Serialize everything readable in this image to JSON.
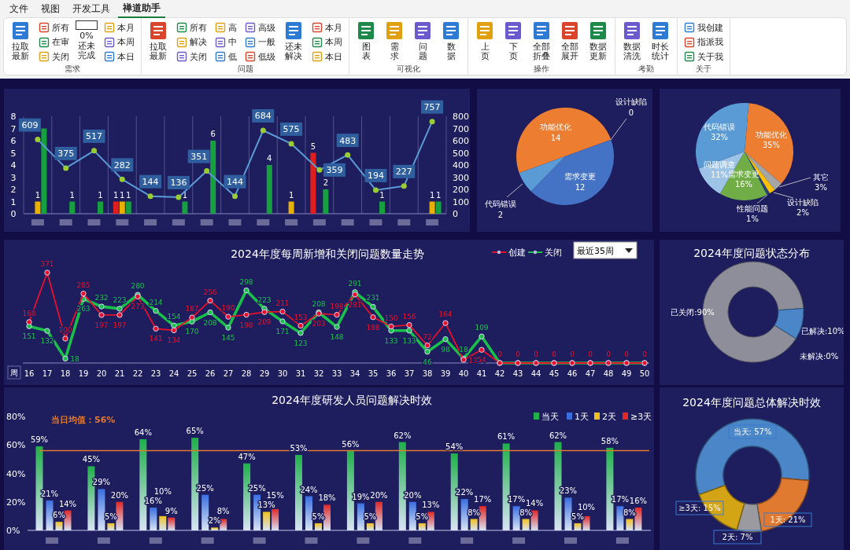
{
  "ribbon": {
    "tabs": [
      {
        "label": "文件",
        "selected": false
      },
      {
        "label": "视图",
        "selected": false
      },
      {
        "label": "开发工具",
        "selected": false
      },
      {
        "label": "禅道助手",
        "selected": true
      }
    ],
    "groups": [
      {
        "label": "需求",
        "columns": [
          {
            "kind": "large",
            "label": "拉取最新"
          },
          {
            "kind": "stack",
            "items": [
              "所有",
              "在审",
              "关闭"
            ]
          },
          {
            "kind": "progress",
            "value": "0%",
            "label": "还未完成",
            "level": 0
          },
          {
            "kind": "stack",
            "items": [
              "本月",
              "本周",
              "本日"
            ]
          }
        ]
      },
      {
        "label": "问题",
        "columns": [
          {
            "kind": "large",
            "label": "拉取最新"
          },
          {
            "kind": "stack",
            "items": [
              "所有",
              "解决",
              "关闭"
            ]
          },
          {
            "kind": "stack",
            "items": [
              "高",
              "中",
              "低"
            ]
          },
          {
            "kind": "stack",
            "items": [
              "高级",
              "一般",
              "低级"
            ]
          },
          {
            "kind": "large",
            "label": "还未解决"
          },
          {
            "kind": "stack",
            "items": [
              "本月",
              "本周",
              "本日"
            ]
          }
        ]
      },
      {
        "label": "可视化",
        "columns": [
          {
            "kind": "large",
            "label": "图表"
          },
          {
            "kind": "large",
            "label": "需求"
          },
          {
            "kind": "large",
            "label": "问题"
          },
          {
            "kind": "large",
            "label": "数据"
          }
        ]
      },
      {
        "label": "操作",
        "columns": [
          {
            "kind": "large",
            "label": "上页"
          },
          {
            "kind": "large",
            "label": "下页"
          },
          {
            "kind": "large",
            "label": "全部折叠"
          },
          {
            "kind": "large",
            "label": "全部展开"
          },
          {
            "kind": "large",
            "label": "数据更新"
          }
        ]
      },
      {
        "label": "考勤",
        "columns": [
          {
            "kind": "large",
            "label": "数据清洗"
          },
          {
            "kind": "large",
            "label": "时长统计"
          }
        ]
      },
      {
        "label": "关于",
        "columns": [
          {
            "kind": "stack",
            "items": [
              "我创建",
              "指派我",
              "关于我"
            ]
          }
        ]
      }
    ]
  },
  "dashboard": {
    "issue_chart": {
      "bar_chart": {
        "chart_data": {
          "type": "bar",
          "yticks": [
            0,
            1,
            2,
            3,
            4,
            5,
            6,
            7,
            8
          ],
          "ylim": [
            0,
            8
          ],
          "data_labels": true,
          "series": [
            {
              "color": "#e01e1e",
              "values": [
                0,
                0,
                0,
                1,
                0,
                0,
                0,
                0,
                0,
                0,
                5,
                0,
                0,
                0,
                0
              ],
              "value_labels": [
                null,
                null,
                null,
                "1",
                null,
                null,
                null,
                null,
                null,
                null,
                "5",
                null,
                null,
                null,
                null
              ]
            },
            {
              "color": "#e8b000",
              "values": [
                1,
                0,
                0,
                1,
                0,
                0,
                0,
                0,
                0,
                1,
                0,
                0,
                0,
                0,
                1
              ],
              "value_labels": [
                "1",
                null,
                null,
                "1",
                null,
                null,
                null,
                null,
                null,
                "1",
                null,
                null,
                null,
                null,
                "1"
              ]
            },
            {
              "color": "#16a040",
              "values": [
                7,
                1,
                1,
                1,
                0,
                1,
                6,
                0,
                4,
                0,
                2,
                0,
                1,
                0,
                1
              ],
              "value_labels": [
                null,
                "1",
                "1",
                "1",
                null,
                "1",
                "6",
                null,
                "4",
                null,
                "2",
                null,
                "1",
                null,
                "1"
              ]
            }
          ]
        }
      },
      "line_chart": {
        "chart_data": {
          "type": "line",
          "yticks": [
            0,
            100,
            200,
            300,
            400,
            500,
            600,
            700,
            800
          ],
          "ylim": [
            0,
            800
          ],
          "data_labels": true,
          "series": [
            {
              "color": "#5b9bd5",
              "marker": "circle",
              "values": [
                609,
                375,
                517,
                282,
                144,
                136,
                351,
                144,
                684,
                575,
                359,
                483,
                194,
                227,
                757
              ],
              "value_labels": [
                "609",
                "375",
                "517",
                "282",
                "144",
                "136",
                "351",
                "144",
                "684",
                "575",
                "359",
                "483",
                "194",
                "227",
                "757"
              ]
            }
          ]
        }
      }
    },
    "category_pie": {
      "chart_data": {
        "type": "pie",
        "categories": [
          "功能优化",
          "设计缺陷",
          "需求变更",
          "代码错误"
        ],
        "values": [
          14,
          0,
          12,
          2
        ],
        "value_labels": [
          "14",
          "0",
          "12",
          "2"
        ],
        "colors": [
          "#ed7d31",
          "#ffc000",
          "#4472c4",
          "#5b9bd5"
        ]
      }
    },
    "type_pie": {
      "chart_data": {
        "type": "pie",
        "categories": [
          "功能优化",
          "其它",
          "设计缺陷",
          "性能问题",
          "需求变更",
          "问题调查",
          "代码错误"
        ],
        "values": [
          35,
          3,
          2,
          1,
          16,
          11,
          32
        ],
        "value_labels": [
          "35%",
          "3%",
          "2%",
          "1%",
          "16%",
          "11%",
          "32%"
        ],
        "colors": [
          "#ed7d31",
          "#a5a5a5",
          "#ffc000",
          "#264478",
          "#70ad47",
          "#9dc3e6",
          "#5b9bd5"
        ]
      }
    },
    "weekly_trend": {
      "dropdown": {
        "value": "最近35周"
      },
      "chart_data": {
        "type": "line",
        "title": "2024年度每周新增和关闭问题数量走势",
        "xlabel": "周",
        "x": [
          "16",
          "17",
          "18",
          "19",
          "20",
          "21",
          "22",
          "23",
          "24",
          "25",
          "26",
          "27",
          "28",
          "29",
          "30",
          "31",
          "32",
          "33",
          "34",
          "35",
          "36",
          "37",
          "38",
          "39",
          "40",
          "41",
          "42",
          "43",
          "44",
          "45",
          "46",
          "47",
          "48",
          "49",
          "50"
        ],
        "legend": "top-right",
        "data_labels": true,
        "series": [
          {
            "name": "创建",
            "color": "#e8102a",
            "marker": "circle",
            "values": [
              168,
              371,
              100,
              285,
              197,
              197,
              273,
              141,
              134,
              187,
              256,
              190,
              198,
              209,
              211,
              153,
              203,
              198,
              281,
              188,
              150,
              156,
              72,
              164,
              13,
              54,
              0,
              0,
              0,
              0,
              0,
              0,
              0,
              0,
              0
            ],
            "value_labels": [
              "168",
              "371",
              "100",
              "285",
              "197",
              "197",
              "273",
              "141",
              "134",
              "187",
              "256",
              "190",
              "198",
              "209",
              "211",
              "153",
              "203",
              "198",
              "281",
              "188",
              "150",
              "156",
              "72",
              "164",
              "13",
              "54",
              "0",
              "0",
              "0",
              "0",
              "0",
              "0",
              "0",
              "0",
              "0"
            ]
          },
          {
            "name": "关闭",
            "color": "#19c04a",
            "marker": "circle",
            "values": [
              151,
              132,
              18,
              263,
              232,
              223,
              280,
              214,
              154,
              170,
              208,
              145,
              298,
              223,
              171,
              123,
              208,
              148,
              291,
              231,
              133,
              133,
              46,
              98,
              18,
              109,
              0,
              0,
              0,
              0,
              0,
              0,
              0,
              0,
              0
            ],
            "value_labels": [
              "151",
              "132",
              "18",
              "263",
              "232",
              "223",
              "280",
              "214",
              "154",
              "170",
              "208",
              "145",
              "298",
              "223",
              "171",
              "123",
              "208",
              "148",
              "291",
              "231",
              "133",
              "133",
              "46",
              "98",
              "18",
              "109",
              null,
              null,
              null,
              null,
              null,
              null,
              null,
              null,
              null
            ]
          }
        ]
      }
    },
    "status_donut": {
      "chart_data": {
        "type": "donut",
        "title": "2024年度问题状态分布",
        "values": [
          90,
          10,
          0
        ],
        "value_labels": [
          "已关闭:90%",
          "已解决:10%",
          "未解决:0%"
        ],
        "colors": [
          "#8e8e9a",
          "#4a86c8",
          "#e07a30"
        ]
      }
    },
    "resolution_chart": {
      "chart_data": {
        "type": "bar",
        "title": "2024年度研发人员问题解决时效",
        "yticks": [
          {
            "value": 0,
            "label": "0%"
          },
          {
            "value": 20,
            "label": "20%"
          },
          {
            "value": 40,
            "label": "40%"
          },
          {
            "value": 60,
            "label": "60%"
          },
          {
            "value": 80,
            "label": "80%"
          }
        ],
        "ylim": [
          0,
          80
        ],
        "legend": "top-right",
        "data_labels": true,
        "ref_lines": [
          {
            "value": 56,
            "axis": "y",
            "color": "#e07a30"
          }
        ],
        "annotations": [
          "当日均值：56%"
        ],
        "series": [
          {
            "name": "当天",
            "color": "#1fb04a",
            "values": [
              59,
              45,
              64,
              65,
              47,
              53,
              56,
              62,
              54,
              61,
              62,
              58
            ],
            "value_labels": [
              "59%",
              "45%",
              "64%",
              "65%",
              "47%",
              "53%",
              "56%",
              "62%",
              "54%",
              "61%",
              "62%",
              "58%"
            ]
          },
          {
            "name": "1天",
            "color": "#3a6ee0",
            "values": [
              21,
              29,
              16,
              25,
              25,
              24,
              19,
              20,
              22,
              17,
              23,
              17
            ],
            "value_labels": [
              "21%",
              "29%",
              "16%",
              "25%",
              "25%",
              "24%",
              "19%",
              "20%",
              "22%",
              "17%",
              "23%",
              "17%"
            ]
          },
          {
            "name": "2天",
            "color": "#f0c020",
            "values": [
              6,
              5,
              10,
              2,
              13,
              5,
              5,
              5,
              8,
              8,
              5,
              8
            ],
            "value_labels": [
              "6%",
              "5%",
              "10%",
              "2%",
              "13%",
              "5%",
              "5%",
              "5%",
              "8%",
              "8%",
              "5%",
              "8%"
            ]
          },
          {
            "name": "≥3天",
            "color": "#e02828",
            "values": [
              14,
              20,
              9,
              8,
              15,
              18,
              20,
              13,
              17,
              14,
              10,
              16
            ],
            "value_labels": [
              "14%",
              "20%",
              "9%",
              "8%",
              "15%",
              "18%",
              "20%",
              "13%",
              "17%",
              "14%",
              "10%",
              "16%"
            ]
          }
        ]
      }
    },
    "overall_donut": {
      "chart_data": {
        "type": "donut",
        "title": "2024年度问题总体解决时效",
        "values": [
          57,
          21,
          7,
          15
        ],
        "value_labels": [
          "当天: 57%",
          "1天: 21%",
          "2天: 7%",
          "≥3天: 15%"
        ],
        "colors": [
          "#4a86c8",
          "#e07a30",
          "#9a9aa0",
          "#d4a417"
        ]
      }
    }
  }
}
